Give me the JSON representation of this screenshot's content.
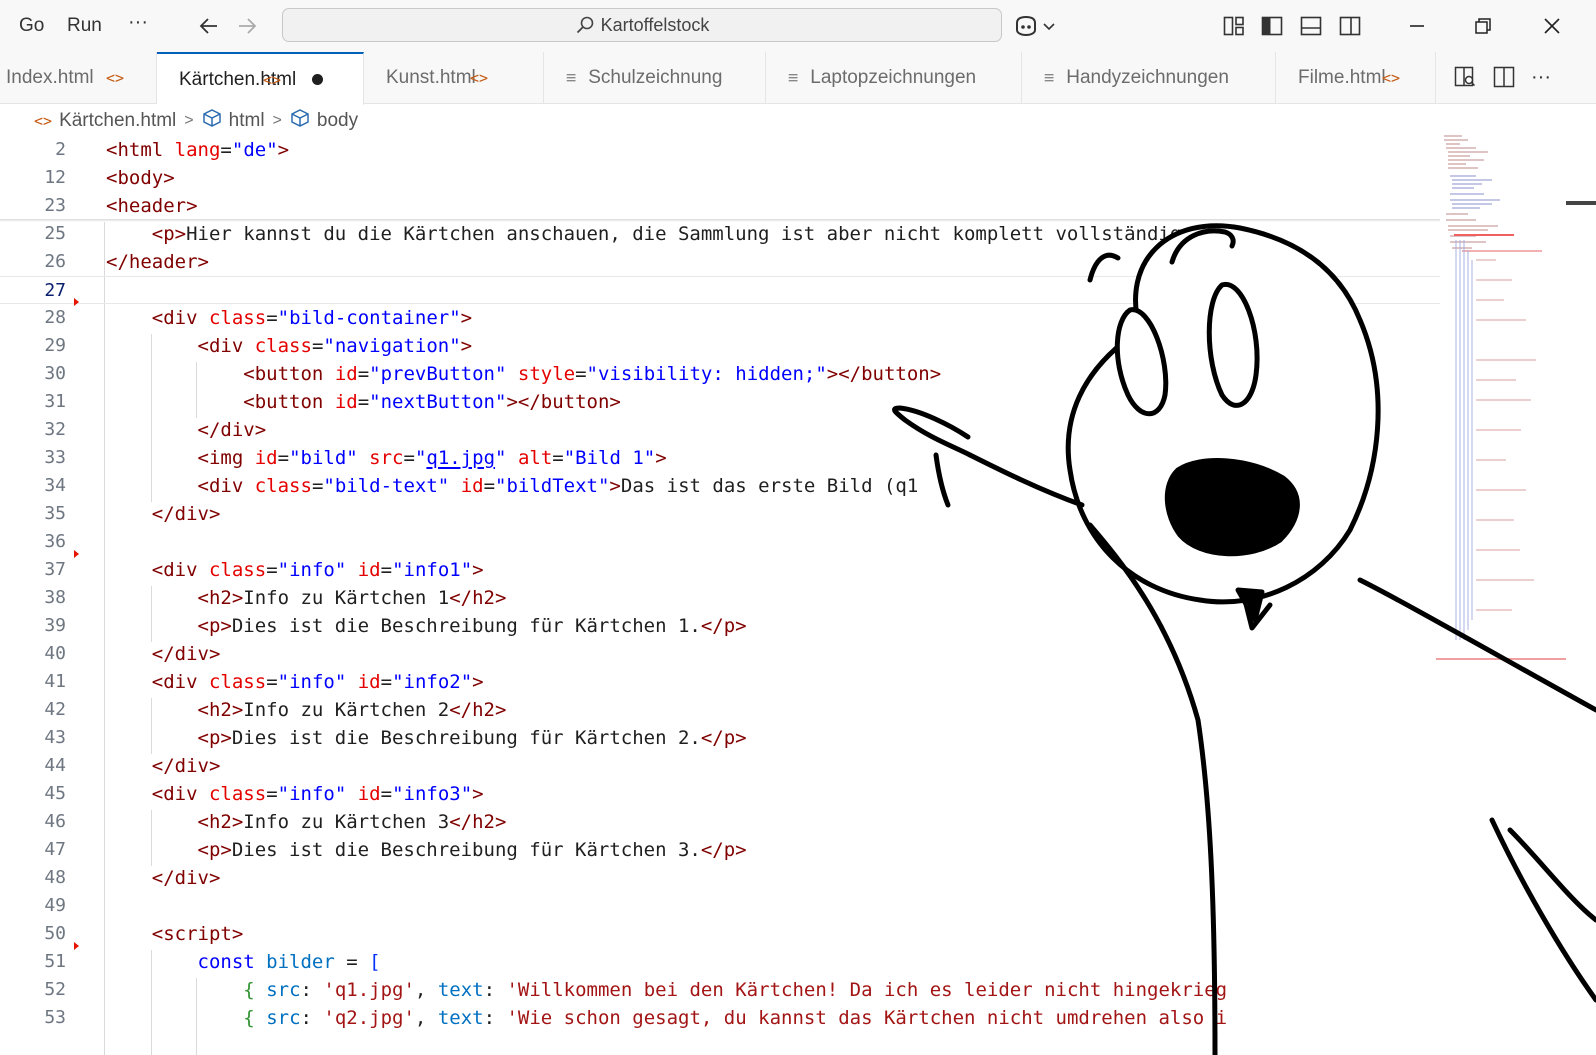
{
  "titlebar": {
    "menu": [
      "Go",
      "Run",
      "···"
    ],
    "search_text": "Kartoffelstock"
  },
  "tabs": [
    {
      "label": "Index.html",
      "icon": "code-icon",
      "active": false
    },
    {
      "label": "Kärtchen.html",
      "icon": "code-icon",
      "active": true,
      "dirty": true
    },
    {
      "label": "Kunst.html",
      "icon": "code-icon",
      "active": false
    },
    {
      "label": "Schulzeichnung",
      "icon": "lines-icon",
      "active": false
    },
    {
      "label": "Laptopzeichnungen",
      "icon": "lines-icon",
      "active": false
    },
    {
      "label": "Handyzeichnungen",
      "icon": "lines-icon",
      "active": false
    },
    {
      "label": "Filme.html",
      "icon": "code-icon",
      "active": false
    }
  ],
  "breadcrumb": [
    "Kärtchen.html",
    "html",
    "body"
  ],
  "editor": {
    "line_numbers": [
      "2",
      "12",
      "23",
      "25",
      "26",
      "27",
      "28",
      "29",
      "30",
      "31",
      "32",
      "33",
      "34",
      "35",
      "36",
      "37",
      "38",
      "39",
      "40",
      "41",
      "42",
      "43",
      "44",
      "45",
      "46",
      "47",
      "48",
      "49",
      "50",
      "51",
      "52",
      "53"
    ],
    "current_line": "27"
  },
  "colors": {
    "tag": "#800000",
    "attribute": "#e50000",
    "string": "#0000ff",
    "keyword": "#0000ff",
    "variable": "#0070c1",
    "js_string": "#a31515",
    "active_tab_border": "#005fb8",
    "fold_marker": "#e51400"
  }
}
